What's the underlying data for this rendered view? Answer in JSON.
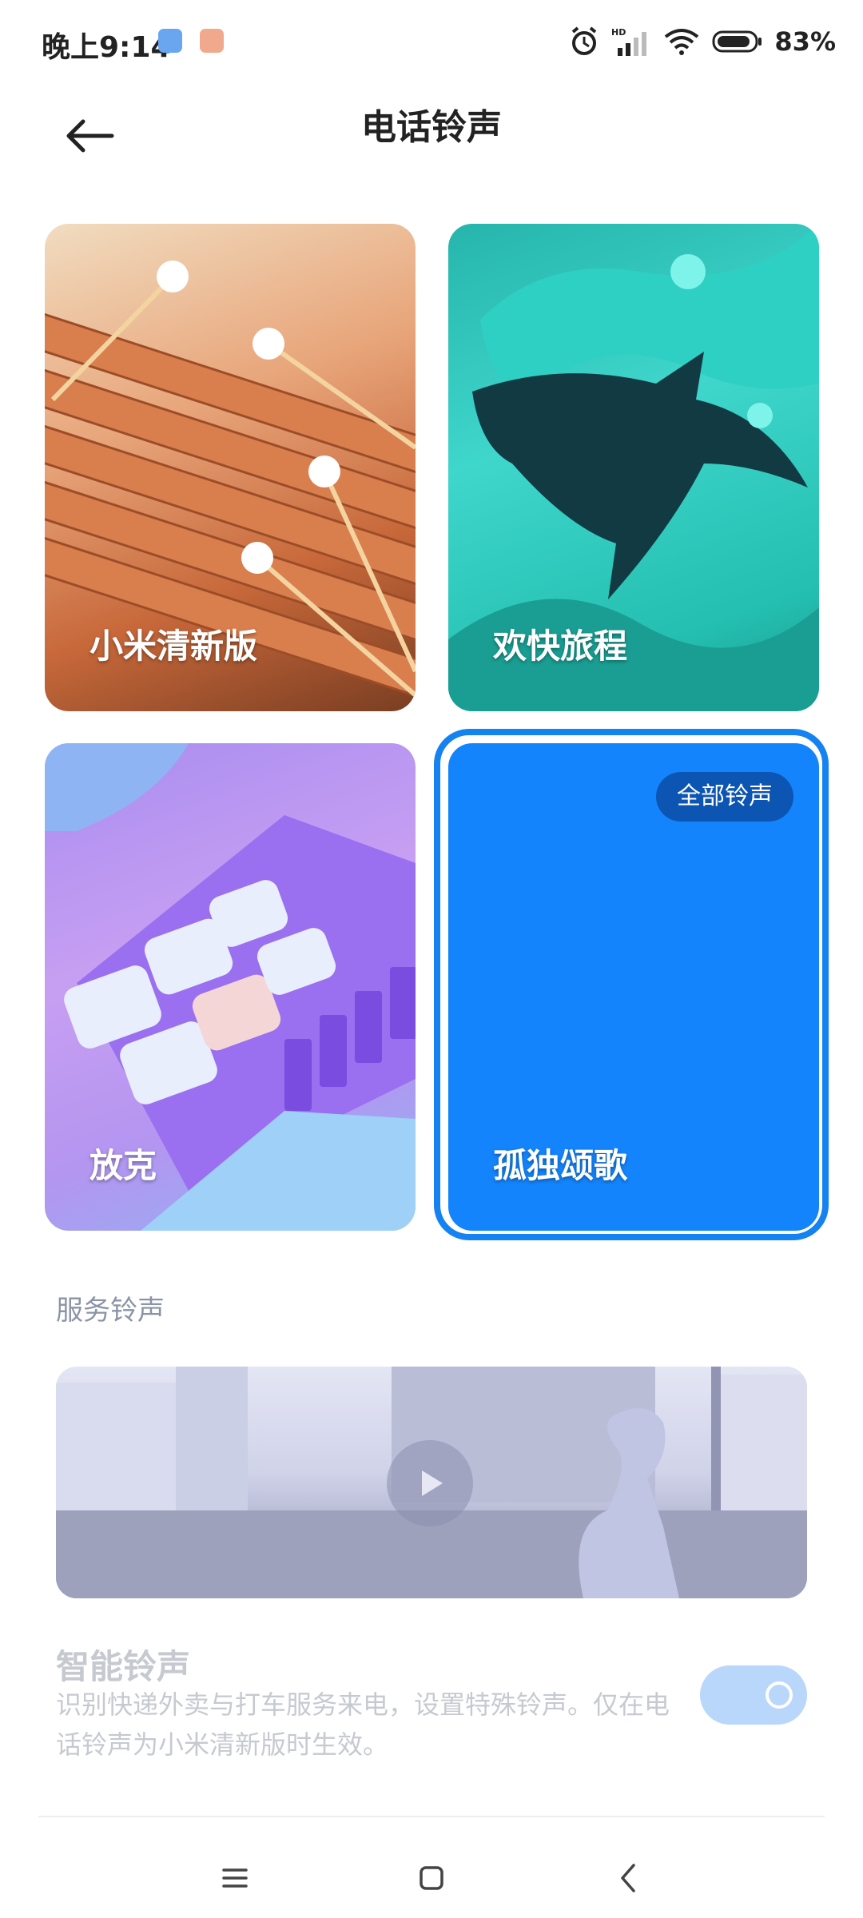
{
  "status_bar": {
    "time": "晚上9:14",
    "battery": "83%",
    "icons": [
      "chat-app-icon",
      "shield-app-icon",
      "alarm-icon",
      "hd-signal-icon",
      "wifi-icon",
      "battery-icon"
    ]
  },
  "header": {
    "title": "电话铃声",
    "back_icon": "arrow-left-icon"
  },
  "ringtones": [
    {
      "title": "小米清新版",
      "selected": false
    },
    {
      "title": "欢快旅程",
      "selected": false
    },
    {
      "title": "放克",
      "selected": false
    },
    {
      "title": "孤独颂歌",
      "selected": true
    }
  ],
  "all_ringtones_label": "全部铃声",
  "service": {
    "section_label": "服务铃声",
    "smart_title": "智能铃声",
    "smart_desc": "识别快递外卖与打车服务来电，设置特殊铃声。仅在电话铃声为小米清新版时生效。",
    "smart_enabled": true
  },
  "nav": [
    "menu-icon",
    "home-icon",
    "back-icon"
  ],
  "colors": {
    "accent": "#1484fc",
    "selected_ring": "#1482f0",
    "toggle_disabled": "#b9d6fb"
  }
}
